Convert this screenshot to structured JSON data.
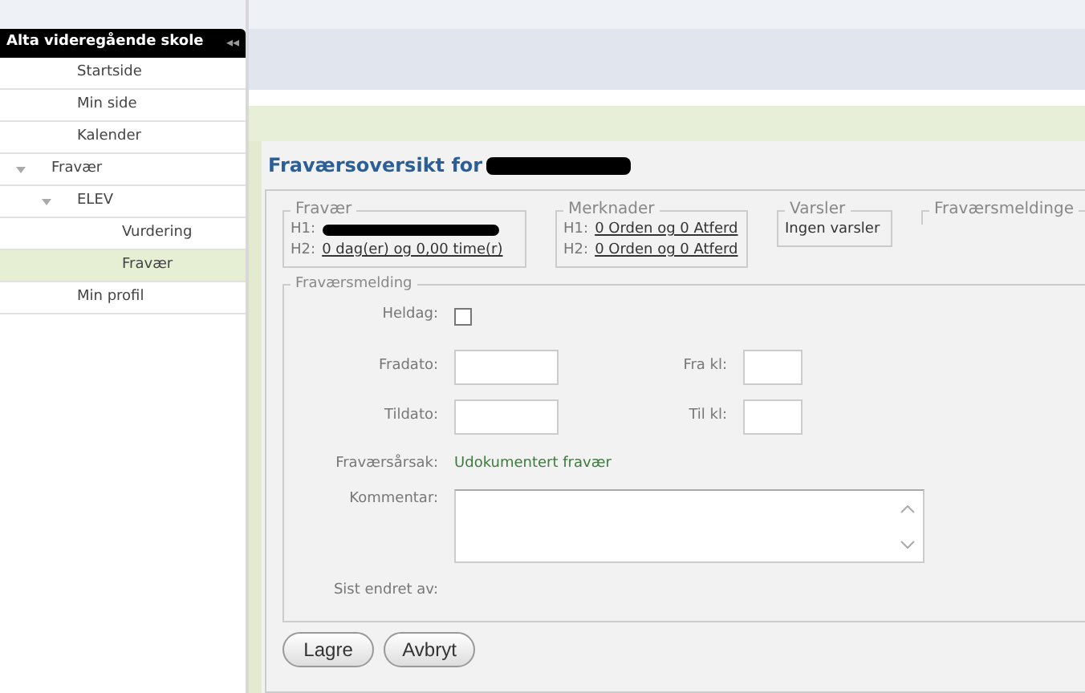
{
  "sidebar": {
    "title": "Alta videregående skole",
    "collapse": "◂◂",
    "items": [
      {
        "label": "Startside",
        "selected": false
      },
      {
        "label": "Min side",
        "selected": false
      },
      {
        "label": "Kalender",
        "selected": false
      },
      {
        "label": "Fravær",
        "selected": false,
        "expanded": true,
        "children": [
          {
            "label": "ELEV",
            "selected": false,
            "expanded": true,
            "children": [
              {
                "label": "Vurdering",
                "selected": false
              },
              {
                "label": "Fravær",
                "selected": true
              }
            ]
          }
        ]
      },
      {
        "label": "Min profil",
        "selected": false
      }
    ]
  },
  "panel": {
    "title": "Fraværsoversikt for",
    "summary": [
      {
        "legend": "Fravær",
        "lines": [
          {
            "label": "H1:"
          },
          {
            "label": "H2:",
            "value": "0 dag(er) og 0,00 time(r)"
          }
        ]
      },
      {
        "legend": "Merknader",
        "lines": [
          {
            "label": "H1:",
            "value": "0 Orden og 0 Atferd"
          },
          {
            "label": "H2:",
            "value": "0 Orden og 0 Atferd"
          }
        ]
      },
      {
        "legend": "Varsler",
        "text": "Ingen varsler"
      },
      {
        "legend": "Fraværsmeldinge"
      }
    ],
    "form": {
      "legend": "Fraværsmelding",
      "heldag_label": "Heldag:",
      "heldag_checked": false,
      "fradato_label": "Fradato:",
      "frakl_label": "Fra kl:",
      "tildato_label": "Tildato:",
      "tilkl_label": "Til kl:",
      "reason_label": "Fraværsårsak:",
      "reason": "Udokumentert fravær",
      "comment_label": "Kommentar:",
      "changed_label": "Sist endret av:"
    },
    "buttons": [
      "Lagre",
      "Avbryt"
    ]
  }
}
